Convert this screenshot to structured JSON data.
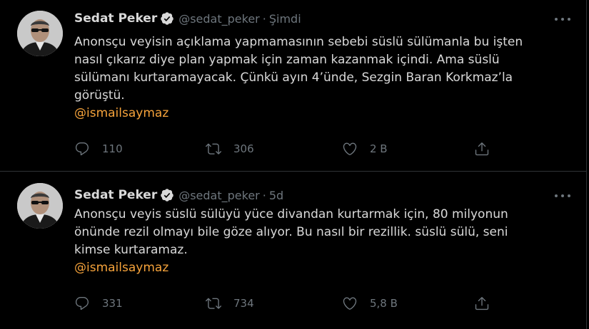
{
  "tweets": [
    {
      "name": "Sedat Peker",
      "handle": "@sedat_peker",
      "separator": "·",
      "time": "Şimdi",
      "text": "Anonsçu veyisin açıklama yapmamasının sebebi süslü sülümanla bu işten nasıl çıkarız diye plan yapmak için zaman kazanmak içindi. Ama süslü sülümanı kurtaramayacak. Çünkü ayın 4’ünde, Sezgin Baran Korkmaz’la görüştü.",
      "mention": "@ismailsaymaz",
      "replies": "110",
      "retweets": "306",
      "likes": "2 B"
    },
    {
      "name": "Sedat Peker",
      "handle": "@sedat_peker",
      "separator": "·",
      "time": "5d",
      "text": "Anonsçu veyis süslü sülüyü yüce divandan kurtarmak için, 80 milyonun önünde rezil olmayı bile göze alıyor. Bu nasıl bir rezillik. süslü sülü, seni kimse kurtaramaz.",
      "mention": "@ismailsaymaz",
      "replies": "331",
      "retweets": "734",
      "likes": "5,8 B"
    }
  ],
  "colors": {
    "background": "#000000",
    "text": "#d9d9d9",
    "muted": "#6e767d",
    "mention": "#f6a33b",
    "verified": "#d9d9d9",
    "divider": "#2f3336"
  },
  "icons": {
    "reply": "speech-bubble-icon",
    "retweet": "retweet-arrows-icon",
    "like": "heart-icon",
    "share": "share-upload-icon",
    "more": "ellipsis-icon",
    "verified": "verified-badge-icon"
  }
}
